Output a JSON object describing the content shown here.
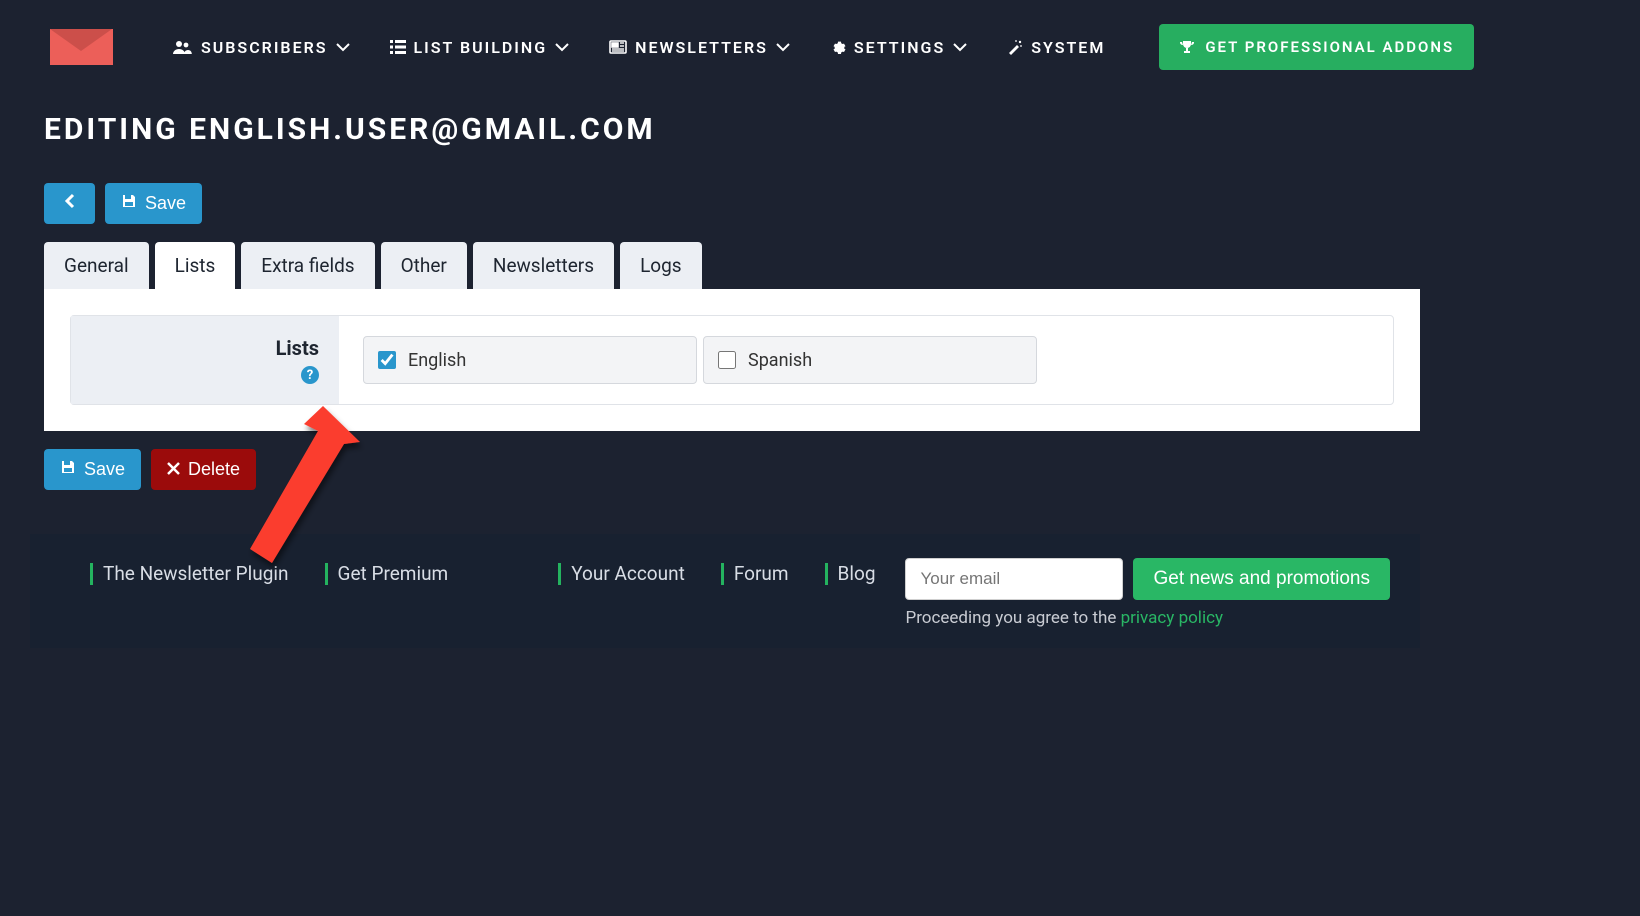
{
  "nav": {
    "subscribers": "SUBSCRIBERS",
    "list_building": "LIST BUILDING",
    "newsletters": "NEWSLETTERS",
    "settings": "SETTINGS",
    "system": "SYSTEM",
    "addons": "GET PROFESSIONAL ADDONS"
  },
  "page_title": "EDITING ENGLISH.USER@GMAIL.COM",
  "buttons": {
    "save": "Save",
    "delete": "Delete"
  },
  "tabs": {
    "general": "General",
    "lists": "Lists",
    "extra_fields": "Extra fields",
    "other": "Other",
    "newsletters": "Newsletters",
    "logs": "Logs",
    "active": "lists"
  },
  "form": {
    "lists_label": "Lists",
    "options": [
      {
        "label": "English",
        "checked": true
      },
      {
        "label": "Spanish",
        "checked": false
      }
    ]
  },
  "footer": {
    "links": {
      "plugin": "The Newsletter Plugin",
      "premium": "Get Premium",
      "account": "Your Account",
      "forum": "Forum",
      "blog": "Blog"
    },
    "subscribe": {
      "placeholder": "Your email",
      "button": "Get news and promotions",
      "consent": "Proceeding you agree to the ",
      "privacy": "privacy policy"
    }
  }
}
